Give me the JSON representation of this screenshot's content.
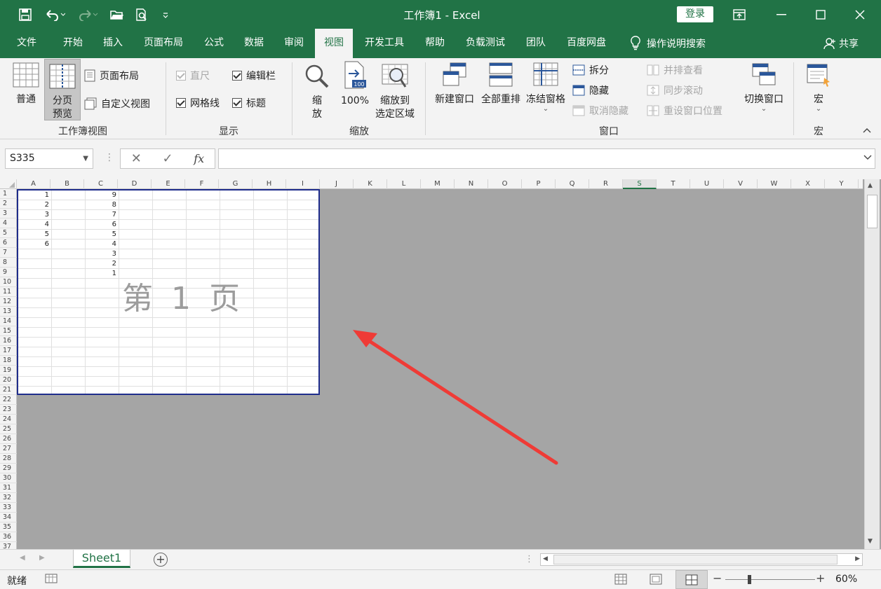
{
  "titlebar": {
    "title": "工作簿1  -  Excel",
    "login": "登录"
  },
  "tabs": [
    "文件",
    "开始",
    "插入",
    "页面布局",
    "公式",
    "数据",
    "审阅",
    "视图",
    "开发工具",
    "帮助",
    "负载测试",
    "团队",
    "百度网盘"
  ],
  "active_tab": "视图",
  "search_label": "操作说明搜索",
  "share_label": "共享",
  "ribbon": {
    "workbook_views": {
      "label": "工作簿视图",
      "normal": "普通",
      "page_break": "分页\n预览",
      "page_layout": "页面布局",
      "custom_views": "自定义视图"
    },
    "show": {
      "label": "显示",
      "ruler": "直尺",
      "formula_bar": "编辑栏",
      "gridlines": "网格线",
      "headings": "标题"
    },
    "zoom": {
      "label": "缩放",
      "zoom": "缩\n放",
      "hundred": "100%",
      "to_selection": "缩放到\n选定区域"
    },
    "window": {
      "label": "窗口",
      "new_window": "新建窗口",
      "arrange_all": "全部重排",
      "freeze_panes": "冻结窗格",
      "split": "拆分",
      "hide": "隐藏",
      "unhide": "取消隐藏",
      "side_by_side": "并排查看",
      "sync_scroll": "同步滚动",
      "reset_position": "重设窗口位置",
      "switch_windows": "切换窗口"
    },
    "macros": {
      "label": "宏",
      "macros": "宏"
    }
  },
  "formula_bar": {
    "name_box": "S335",
    "fx": "fx",
    "value": ""
  },
  "grid": {
    "columns": [
      "A",
      "B",
      "C",
      "D",
      "E",
      "F",
      "G",
      "H",
      "I",
      "J",
      "K",
      "L",
      "M",
      "N",
      "O",
      "P",
      "Q",
      "R",
      "S",
      "T",
      "U",
      "V",
      "W",
      "X",
      "Y"
    ],
    "active_column": "S",
    "rows": 37,
    "col_a": [
      "1",
      "2",
      "3",
      "4",
      "5",
      "6"
    ],
    "col_c": [
      "9",
      "8",
      "7",
      "6",
      "5",
      "4",
      "3",
      "2",
      "1"
    ],
    "watermark": "第 1 页"
  },
  "sheet_tab": "Sheet1",
  "status": {
    "ready": "就绪",
    "zoom": "60%"
  },
  "colors": {
    "excel_green": "#217346",
    "page_border": "#1f2d8c",
    "arrow": "#ef3b36"
  }
}
